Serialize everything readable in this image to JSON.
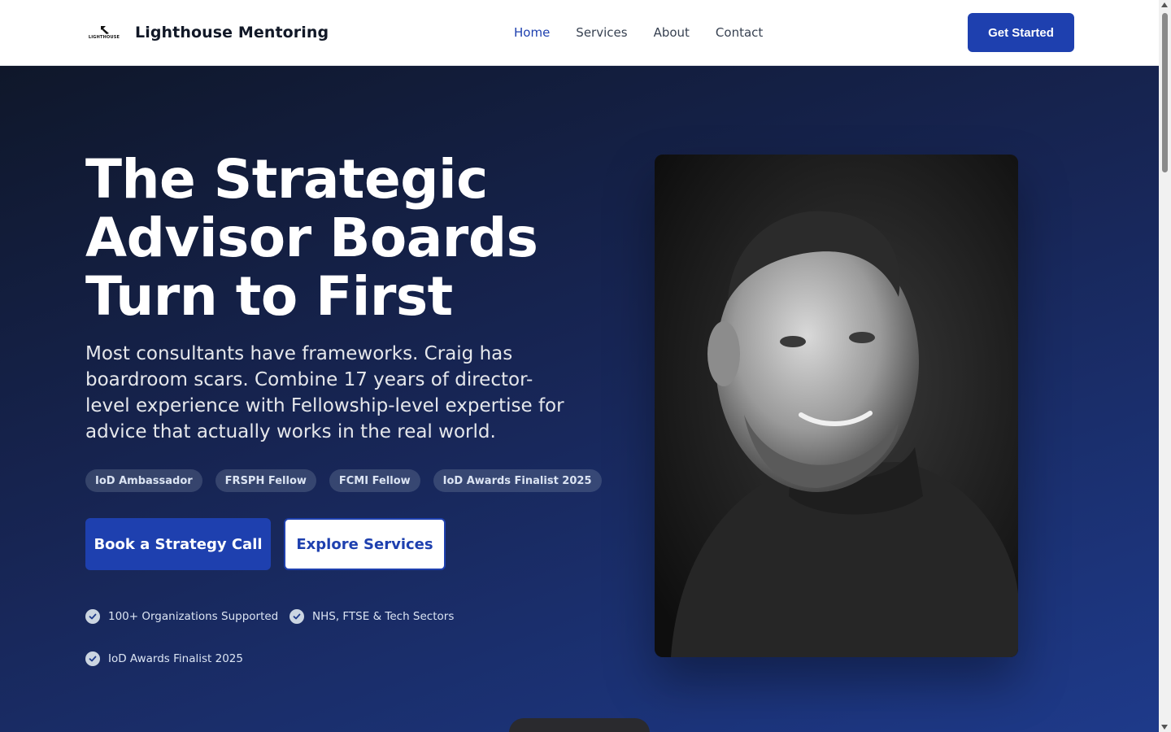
{
  "brand": {
    "logo_text": "LIGHTHOUSE",
    "name": "Lighthouse Mentoring"
  },
  "nav": {
    "items": [
      {
        "label": "Home",
        "active": true
      },
      {
        "label": "Services",
        "active": false
      },
      {
        "label": "About",
        "active": false
      },
      {
        "label": "Contact",
        "active": false
      }
    ]
  },
  "header": {
    "cta_label": "Get Started"
  },
  "hero": {
    "headline_lines": [
      "The Strategic",
      "Advisor Boards",
      "Turn to First"
    ],
    "subtext": "Most consultants have frameworks. Craig has boardroom scars. Combine 17 years of director-level experience with Fellowship-level expertise for advice that actually works in the real world.",
    "badges": [
      "IoD Ambassador",
      "FRSPH Fellow",
      "FCMI Fellow",
      "IoD Awards Finalist 2025"
    ],
    "primary_button": "Book a Strategy Call",
    "secondary_button": "Explore Services",
    "stats": [
      "100+ Organizations Supported",
      "NHS, FTSE & Tech Sectors",
      "IoD Awards Finalist 2025"
    ]
  },
  "colors": {
    "accent": "#1e40af",
    "hero_start": "#0f172a",
    "hero_end": "#1e3a8a",
    "text_primary": "#111827"
  },
  "icons": {
    "check": "check-circle-icon",
    "logo": "lighthouse-logo-icon"
  }
}
